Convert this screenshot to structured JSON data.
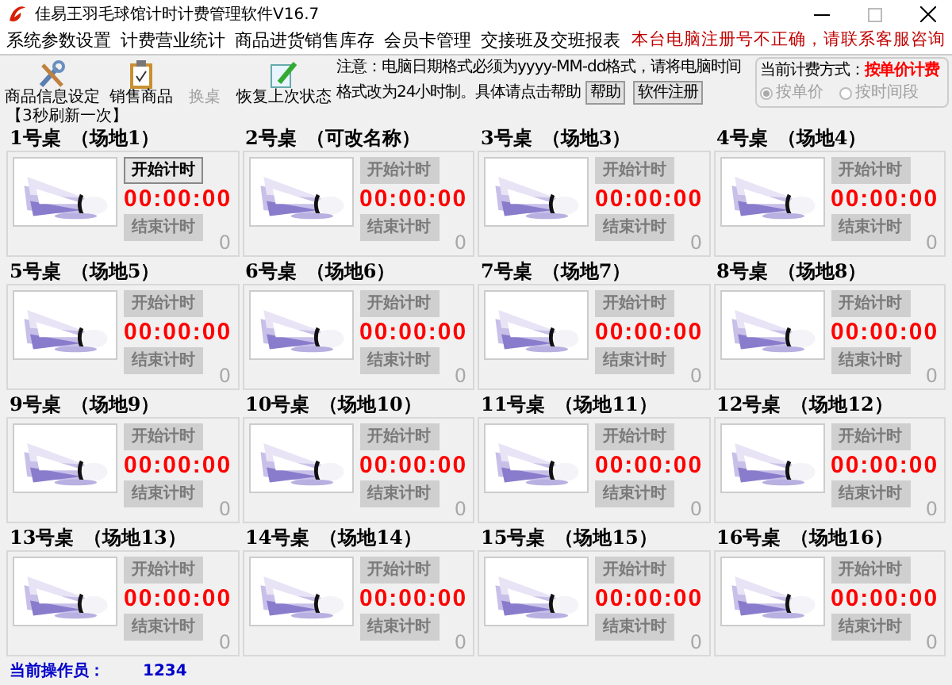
{
  "window": {
    "title": "佳易王羽毛球馆计时计费管理软件V16.7"
  },
  "menu": [
    "系统参数设置",
    "计费营业统计",
    "商品进货销售库存",
    "会员卡管理",
    "交接班及交班报表"
  ],
  "registration_warning": "本台电脑注册号不正确，请联系客服咨询",
  "toolbar": [
    {
      "label": "商品信息设定",
      "kind": "tools",
      "disabled": false
    },
    {
      "label": "销售商品",
      "kind": "clipboard",
      "disabled": false
    },
    {
      "label": "换桌",
      "kind": "none",
      "disabled": true
    },
    {
      "label": "恢复上次状态",
      "kind": "pen",
      "disabled": false
    }
  ],
  "notice": {
    "line1": "注意：电脑日期格式必须为yyyy-MM-dd格式，请将电脑时间",
    "line2": "格式改为24小时制。具体请点击帮助",
    "help_button": "帮助",
    "register_button": "软件注册"
  },
  "billing": {
    "label": "当前计费方式：",
    "mode": "按单价计费",
    "options": [
      {
        "label": "按单价",
        "selected": true,
        "disabled": true
      },
      {
        "label": "按时间段",
        "selected": false,
        "disabled": true
      }
    ]
  },
  "refresh_note": "【3秒刷新一次】",
  "tables": [
    {
      "name": "1号桌",
      "venue": "（场地1）",
      "start": "开始计时",
      "start_enabled": true,
      "time": "00:00:00",
      "end": "结束计时",
      "end_enabled": false,
      "count": "0"
    },
    {
      "name": "2号桌",
      "venue": "（可改名称）",
      "start": "开始计时",
      "start_enabled": false,
      "time": "00:00:00",
      "end": "结束计时",
      "end_enabled": false,
      "count": "0"
    },
    {
      "name": "3号桌",
      "venue": "（场地3）",
      "start": "开始计时",
      "start_enabled": false,
      "time": "00:00:00",
      "end": "结束计时",
      "end_enabled": false,
      "count": "0"
    },
    {
      "name": "4号桌",
      "venue": "（场地4）",
      "start": "开始计时",
      "start_enabled": false,
      "time": "00:00:00",
      "end": "结束计时",
      "end_enabled": false,
      "count": "0"
    },
    {
      "name": "5号桌",
      "venue": "（场地5）",
      "start": "开始计时",
      "start_enabled": false,
      "time": "00:00:00",
      "end": "结束计时",
      "end_enabled": false,
      "count": "0"
    },
    {
      "name": "6号桌",
      "venue": "（场地6）",
      "start": "开始计时",
      "start_enabled": false,
      "time": "00:00:00",
      "end": "结束计时",
      "end_enabled": false,
      "count": "0"
    },
    {
      "name": "7号桌",
      "venue": "（场地7）",
      "start": "开始计时",
      "start_enabled": false,
      "time": "00:00:00",
      "end": "结束计时",
      "end_enabled": false,
      "count": "0"
    },
    {
      "name": "8号桌",
      "venue": "（场地8）",
      "start": "开始计时",
      "start_enabled": false,
      "time": "00:00:00",
      "end": "结束计时",
      "end_enabled": false,
      "count": "0"
    },
    {
      "name": "9号桌",
      "venue": "（场地9）",
      "start": "开始计时",
      "start_enabled": false,
      "time": "00:00:00",
      "end": "结束计时",
      "end_enabled": false,
      "count": "0"
    },
    {
      "name": "10号桌",
      "venue": "（场地10）",
      "start": "开始计时",
      "start_enabled": false,
      "time": "00:00:00",
      "end": "结束计时",
      "end_enabled": false,
      "count": "0"
    },
    {
      "name": "11号桌",
      "venue": "（场地11）",
      "start": "开始计时",
      "start_enabled": false,
      "time": "00:00:00",
      "end": "结束计时",
      "end_enabled": false,
      "count": "0"
    },
    {
      "name": "12号桌",
      "venue": "（场地12）",
      "start": "开始计时",
      "start_enabled": false,
      "time": "00:00:00",
      "end": "结束计时",
      "end_enabled": false,
      "count": "0"
    },
    {
      "name": "13号桌",
      "venue": "（场地13）",
      "start": "开始计时",
      "start_enabled": false,
      "time": "00:00:00",
      "end": "结束计时",
      "end_enabled": false,
      "count": "0"
    },
    {
      "name": "14号桌",
      "venue": "（场地14）",
      "start": "开始计时",
      "start_enabled": false,
      "time": "00:00:00",
      "end": "结束计时",
      "end_enabled": false,
      "count": "0"
    },
    {
      "name": "15号桌",
      "venue": "（场地15）",
      "start": "开始计时",
      "start_enabled": false,
      "time": "00:00:00",
      "end": "结束计时",
      "end_enabled": false,
      "count": "0"
    },
    {
      "name": "16号桌",
      "venue": "（场地16）",
      "start": "开始计时",
      "start_enabled": false,
      "time": "00:00:00",
      "end": "结束计时",
      "end_enabled": false,
      "count": "0"
    }
  ],
  "status_bar": {
    "label": "当前操作员：",
    "value": "1234"
  }
}
